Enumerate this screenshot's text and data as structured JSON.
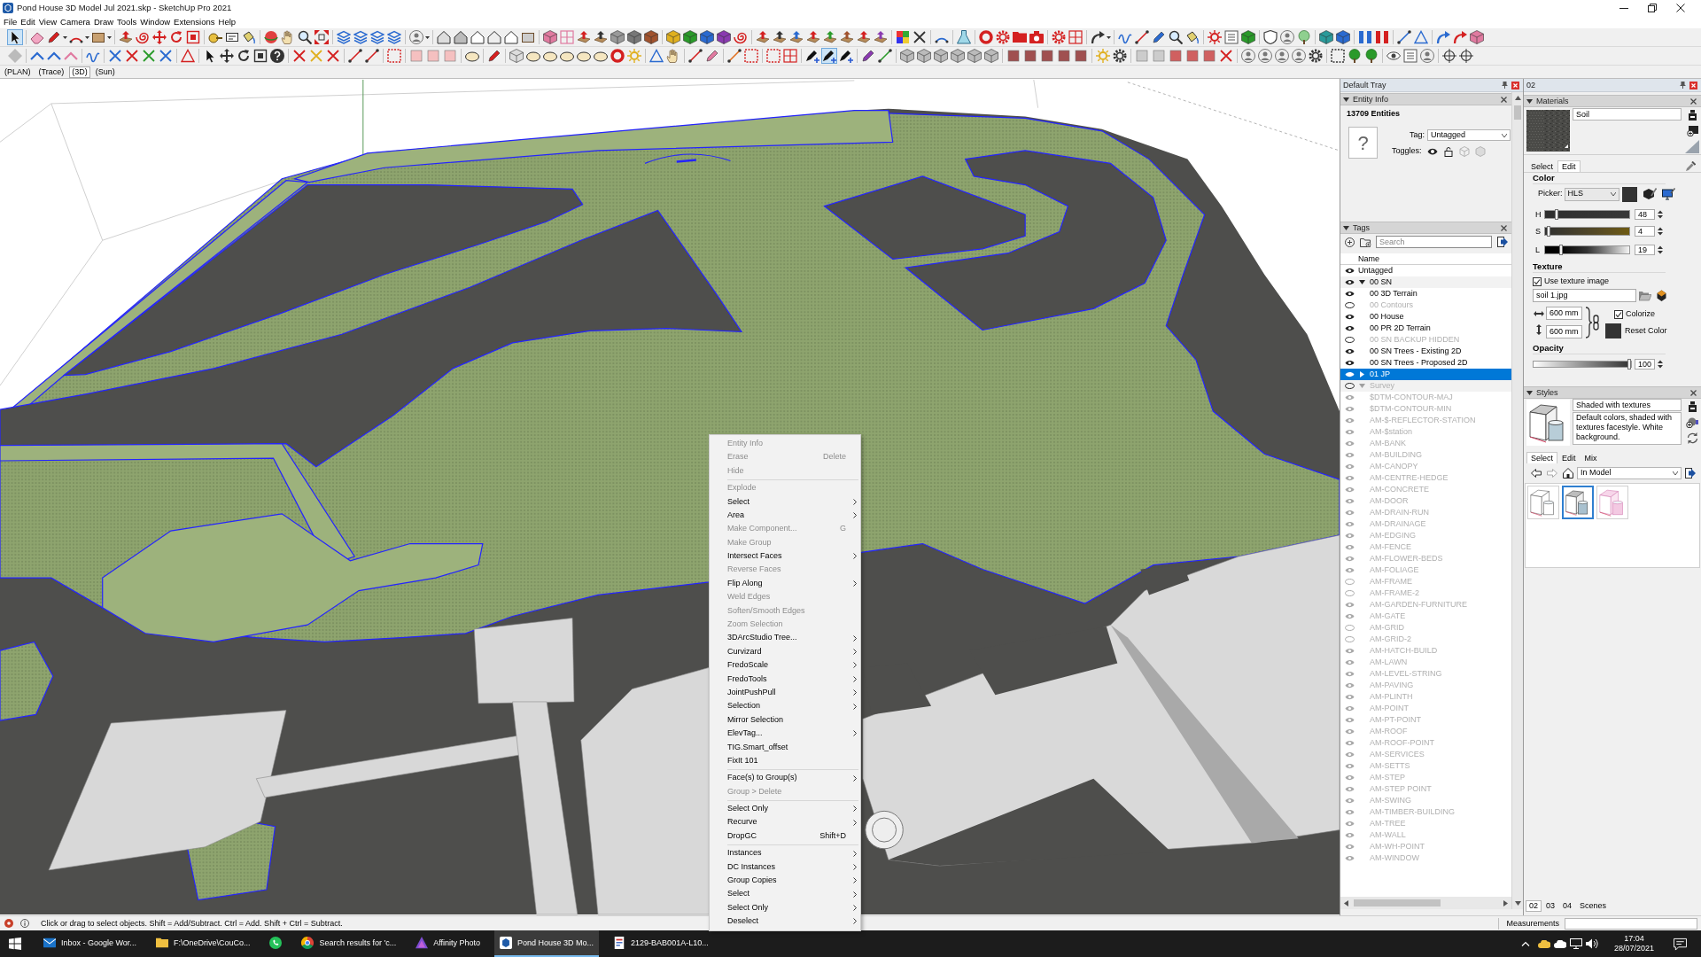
{
  "window": {
    "title": "Pond House 3D Model Jul 2021.skp - SketchUp Pro 2021"
  },
  "menu_bar": [
    "File",
    "Edit",
    "View",
    "Camera",
    "Draw",
    "Tools",
    "Window",
    "Extensions",
    "Help"
  ],
  "toolbars": [
    {
      "groups": [
        [
          {
            "selected": true
          }
        ],
        [
          {
            "selected": false
          },
          {
            "selected": false
          },
          {
            "selected": false
          },
          {
            "selected": false
          }
        ],
        [
          {
            "selected": false
          },
          {
            "selected": false
          },
          {
            "selected": false
          },
          {
            "selected": false
          },
          {
            "selected": false
          }
        ],
        [
          {
            "selected": false
          },
          {
            "selected": false
          },
          {
            "selected": false
          }
        ],
        [
          {
            "selected": false
          },
          {
            "selected": false
          },
          {
            "selected": false
          },
          {
            "selected": false
          }
        ],
        [
          {
            "selected": false
          },
          {
            "selected": false
          },
          {
            "selected": false
          },
          {
            "selected": false
          }
        ],
        [
          {
            "selected": false
          }
        ],
        [
          {
            "selected": false
          },
          {
            "selected": false
          },
          {
            "selected": false
          },
          {
            "selected": false
          },
          {
            "selected": false
          },
          {
            "selected": false
          }
        ],
        [
          {
            "selected": false
          },
          {
            "selected": false
          },
          {
            "selected": false
          },
          {
            "selected": false
          },
          {
            "selected": false
          },
          {
            "selected": false
          },
          {
            "selected": false
          }
        ],
        [
          {
            "selected": false
          },
          {
            "selected": false
          },
          {
            "selected": false
          },
          {
            "selected": false
          },
          {
            "selected": false
          }
        ],
        [
          {
            "selected": false
          },
          {
            "selected": false
          },
          {
            "selected": false
          },
          {
            "selected": false
          },
          {
            "selected": false
          },
          {
            "selected": false
          },
          {
            "selected": false
          },
          {
            "selected": false
          }
        ],
        [
          {
            "selected": false
          },
          {
            "selected": false
          }
        ],
        [
          {
            "selected": false
          }
        ],
        [
          {
            "selected": false
          }
        ],
        [
          {
            "selected": false
          },
          {
            "selected": false
          },
          {
            "selected": false
          },
          {
            "selected": false
          }
        ],
        [
          {
            "selected": false
          },
          {
            "selected": false
          }
        ],
        [
          {
            "selected": false
          }
        ],
        [
          {
            "selected": false
          },
          {
            "selected": false
          },
          {
            "selected": false
          },
          {
            "selected": false
          },
          {
            "selected": false
          }
        ],
        [
          {
            "selected": false
          },
          {
            "selected": false
          },
          {
            "selected": false
          }
        ],
        [
          {
            "selected": false
          },
          {
            "selected": false
          },
          {
            "selected": false
          }
        ],
        [
          {
            "selected": false
          },
          {
            "selected": false
          }
        ],
        [
          {
            "selected": false
          },
          {
            "selected": false
          }
        ],
        [
          {
            "selected": false
          },
          {
            "selected": false
          }
        ],
        [
          {
            "selected": false
          },
          {
            "selected": false
          },
          {
            "selected": false
          }
        ]
      ]
    },
    {
      "groups": [
        [
          {
            "selected": false
          }
        ],
        [
          {
            "selected": false
          },
          {
            "selected": false
          },
          {
            "selected": false
          }
        ],
        [
          {
            "selected": false
          }
        ],
        [
          {
            "selected": false
          },
          {
            "selected": false
          },
          {
            "selected": false
          },
          {
            "selected": false
          }
        ],
        [
          {
            "selected": false
          }
        ],
        [
          {
            "selected": false
          },
          {
            "selected": false
          },
          {
            "selected": false
          },
          {
            "selected": false
          },
          {
            "selected": false
          }
        ],
        [
          {
            "selected": false
          },
          {
            "selected": false
          },
          {
            "selected": false
          }
        ],
        [
          {
            "selected": false
          },
          {
            "selected": false
          }
        ],
        [
          {
            "selected": false
          }
        ],
        [
          {
            "selected": false
          },
          {
            "selected": false
          },
          {
            "selected": false
          }
        ],
        [
          {
            "selected": false
          }
        ],
        [
          {
            "selected": false
          }
        ],
        [
          {
            "selected": false
          },
          {
            "selected": false
          },
          {
            "selected": false
          },
          {
            "selected": false
          },
          {
            "selected": false
          },
          {
            "selected": false
          },
          {
            "selected": false
          },
          {
            "selected": false
          }
        ],
        [
          {
            "selected": false
          },
          {
            "selected": false
          }
        ],
        [
          {
            "selected": false
          },
          {
            "selected": false
          }
        ],
        [
          {
            "selected": false
          },
          {
            "selected": false
          }
        ],
        [
          {
            "selected": false
          },
          {
            "selected": false
          }
        ],
        [
          {
            "selected": false
          },
          {
            "selected": true
          },
          {
            "selected": false
          }
        ],
        [
          {
            "selected": false
          },
          {
            "selected": false
          }
        ],
        [
          {
            "selected": false
          },
          {
            "selected": false
          },
          {
            "selected": false
          },
          {
            "selected": false
          },
          {
            "selected": false
          },
          {
            "selected": false
          }
        ],
        [
          {
            "selected": false
          },
          {
            "selected": false
          },
          {
            "selected": false
          },
          {
            "selected": false
          },
          {
            "selected": false
          }
        ],
        [
          {
            "selected": false
          },
          {
            "selected": false
          }
        ],
        [
          {
            "selected": false
          },
          {
            "selected": false
          },
          {
            "selected": false
          },
          {
            "selected": false
          },
          {
            "selected": false
          },
          {
            "selected": false
          }
        ],
        [
          {
            "selected": false
          },
          {
            "selected": false
          },
          {
            "selected": false
          },
          {
            "selected": false
          },
          {
            "selected": false
          }
        ],
        [
          {
            "selected": false
          },
          {
            "selected": false
          },
          {
            "selected": false
          }
        ],
        [
          {
            "selected": false
          },
          {
            "selected": false
          },
          {
            "selected": false
          }
        ],
        [
          {
            "selected": false
          },
          {
            "selected": false
          }
        ]
      ]
    }
  ],
  "scene_tabs": [
    {
      "label": "(PLAN)",
      "selected": false
    },
    {
      "label": "(Trace)",
      "selected": false
    },
    {
      "label": "(3D)",
      "selected": true
    },
    {
      "label": "(Sun)",
      "selected": false
    }
  ],
  "context_menu": {
    "groups": [
      [
        {
          "label": "Entity Info",
          "disabled": true,
          "submenu": false
        },
        {
          "label": "Erase",
          "shortcut": "Delete",
          "disabled": true,
          "submenu": false
        },
        {
          "label": "Hide",
          "disabled": true,
          "submenu": false
        }
      ],
      [
        {
          "label": "Explode",
          "disabled": true,
          "submenu": false
        },
        {
          "label": "Select",
          "disabled": false,
          "submenu": true
        },
        {
          "label": "Area",
          "disabled": false,
          "submenu": true
        },
        {
          "label": "Make Component...",
          "shortcut": "G",
          "disabled": true,
          "submenu": false
        },
        {
          "label": "Make Group",
          "disabled": true,
          "submenu": false
        },
        {
          "label": "Intersect Faces",
          "disabled": false,
          "submenu": true
        },
        {
          "label": "Reverse Faces",
          "disabled": true,
          "submenu": false
        },
        {
          "label": "Flip Along",
          "disabled": false,
          "submenu": true
        },
        {
          "label": "Weld Edges",
          "disabled": true,
          "submenu": false
        },
        {
          "label": "Soften/Smooth Edges",
          "disabled": true,
          "submenu": false
        },
        {
          "label": "Zoom Selection",
          "disabled": true,
          "submenu": false
        },
        {
          "label": "3DArcStudio Tree...",
          "disabled": false,
          "submenu": true
        },
        {
          "label": "Curvizard",
          "disabled": false,
          "submenu": true
        },
        {
          "label": "FredoScale",
          "disabled": false,
          "submenu": true
        },
        {
          "label": "FredoTools",
          "disabled": false,
          "submenu": true
        },
        {
          "label": "JointPushPull",
          "disabled": false,
          "submenu": true
        },
        {
          "label": "Selection",
          "disabled": false,
          "submenu": true
        },
        {
          "label": "Mirror Selection",
          "disabled": false,
          "submenu": false
        },
        {
          "label": "ElevTag...",
          "disabled": false,
          "submenu": true
        },
        {
          "label": "TIG.Smart_offset",
          "disabled": false,
          "submenu": false
        },
        {
          "label": "FixIt 101",
          "disabled": false,
          "submenu": false
        }
      ],
      [
        {
          "label": "Face(s) to Group(s)",
          "disabled": false,
          "submenu": true
        },
        {
          "label": "Group > Delete",
          "disabled": true,
          "submenu": false
        }
      ],
      [
        {
          "label": "Select Only",
          "disabled": false,
          "submenu": true
        },
        {
          "label": "Recurve",
          "disabled": false,
          "submenu": true
        },
        {
          "label": "DropGC",
          "shortcut": "Shift+D",
          "disabled": false,
          "submenu": false
        }
      ],
      [
        {
          "label": "Instances",
          "disabled": false,
          "submenu": true
        },
        {
          "label": "DC Instances",
          "disabled": false,
          "submenu": true
        },
        {
          "label": "Group Copies",
          "disabled": false,
          "submenu": true
        },
        {
          "label": "Select",
          "disabled": false,
          "submenu": true
        },
        {
          "label": "Select Only",
          "disabled": false,
          "submenu": true
        },
        {
          "label": "Deselect",
          "disabled": false,
          "submenu": true
        }
      ]
    ]
  },
  "default_tray": {
    "title": "Default Tray",
    "entity_info": {
      "title": "Entity Info",
      "expanded": true,
      "count": "13709 Entities",
      "preview": "?",
      "tag_label": "Tag:",
      "tag_value": "Untagged",
      "toggles_label": "Toggles:",
      "toggles": [
        {
          "disabled": false
        },
        {
          "disabled": false
        },
        {
          "disabled": true
        },
        {
          "disabled": true
        }
      ]
    },
    "tags": {
      "title": "Tags",
      "expanded": true,
      "search": {
        "placeholder": "Search"
      },
      "column": "Name",
      "items": [
        {
          "name": "Untagged",
          "visible": true,
          "selected": false
        },
        {
          "name": "00 SN",
          "visible": true,
          "selected": false,
          "expanded": true,
          "children": [
            {
              "name": "00 3D Terrain",
              "visible": true,
              "selected": false
            },
            {
              "name": "00 Contours",
              "visible": false,
              "selected": false
            },
            {
              "name": "00 House",
              "visible": true,
              "selected": false
            },
            {
              "name": "00 PR 2D Terrain",
              "visible": true,
              "selected": false
            },
            {
              "name": "00 SN BACKUP HIDDEN",
              "visible": false,
              "selected": false
            },
            {
              "name": "00 SN Trees - Existing 2D",
              "visible": true,
              "selected": false
            },
            {
              "name": "00 SN Trees - Proposed 2D",
              "visible": true,
              "selected": false
            }
          ]
        },
        {
          "name": "01 JP",
          "visible": true,
          "selected": true,
          "expanded": false
        },
        {
          "name": "Survey",
          "visible": false,
          "selected": false,
          "expanded": true,
          "children": [
            {
              "name": "$DTM-CONTOUR-MAJ",
              "visible": true,
              "selected": false
            },
            {
              "name": "$DTM-CONTOUR-MIN",
              "visible": true,
              "selected": false
            },
            {
              "name": "AM-$-REFLECTOR-STATION",
              "visible": true,
              "selected": false
            },
            {
              "name": "AM-$station",
              "visible": true,
              "selected": false
            },
            {
              "name": "AM-BANK",
              "visible": true,
              "selected": false
            },
            {
              "name": "AM-BUILDING",
              "visible": true,
              "selected": false
            },
            {
              "name": "AM-CANOPY",
              "visible": true,
              "selected": false
            },
            {
              "name": "AM-CENTRE-HEDGE",
              "visible": true,
              "selected": false
            },
            {
              "name": "AM-CONCRETE",
              "visible": true,
              "selected": false
            },
            {
              "name": "AM-DOOR",
              "visible": true,
              "selected": false
            },
            {
              "name": "AM-DRAIN-RUN",
              "visible": true,
              "selected": false
            },
            {
              "name": "AM-DRAINAGE",
              "visible": true,
              "selected": false
            },
            {
              "name": "AM-EDGING",
              "visible": true,
              "selected": false
            },
            {
              "name": "AM-FENCE",
              "visible": true,
              "selected": false
            },
            {
              "name": "AM-FLOWER-BEDS",
              "visible": true,
              "selected": false
            },
            {
              "name": "AM-FOLIAGE",
              "visible": true,
              "selected": false
            },
            {
              "name": "AM-FRAME",
              "visible": false,
              "selected": false
            },
            {
              "name": "AM-FRAME-2",
              "visible": false,
              "selected": false
            },
            {
              "name": "AM-GARDEN-FURNITURE",
              "visible": true,
              "selected": false
            },
            {
              "name": "AM-GATE",
              "visible": true,
              "selected": false
            },
            {
              "name": "AM-GRID",
              "visible": false,
              "selected": false
            },
            {
              "name": "AM-GRID-2",
              "visible": false,
              "selected": false
            },
            {
              "name": "AM-HATCH-BUILD",
              "visible": true,
              "selected": false
            },
            {
              "name": "AM-LAWN",
              "visible": true,
              "selected": false
            },
            {
              "name": "AM-LEVEL-STRING",
              "visible": true,
              "selected": false
            },
            {
              "name": "AM-PAVING",
              "visible": true,
              "selected": false
            },
            {
              "name": "AM-PLINTH",
              "visible": true,
              "selected": false
            },
            {
              "name": "AM-POINT",
              "visible": true,
              "selected": false
            },
            {
              "name": "AM-PT-POINT",
              "visible": true,
              "selected": false
            },
            {
              "name": "AM-ROOF",
              "visible": true,
              "selected": false
            },
            {
              "name": "AM-ROOF-POINT",
              "visible": true,
              "selected": false
            },
            {
              "name": "AM-SERVICES",
              "visible": true,
              "selected": false
            },
            {
              "name": "AM-SETTS",
              "visible": true,
              "selected": false
            },
            {
              "name": "AM-STEP",
              "visible": true,
              "selected": false
            },
            {
              "name": "AM-STEP POINT",
              "visible": true,
              "selected": false
            },
            {
              "name": "AM-SWING",
              "visible": true,
              "selected": false
            },
            {
              "name": "AM-TIMBER-BUILDING",
              "visible": true,
              "selected": false
            },
            {
              "name": "AM-TREE",
              "visible": true,
              "selected": false
            },
            {
              "name": "AM-WALL",
              "visible": true,
              "selected": false
            },
            {
              "name": "AM-WH-POINT",
              "visible": true,
              "selected": false
            },
            {
              "name": "AM-WINDOW",
              "visible": true,
              "selected": false
            }
          ]
        }
      ]
    }
  },
  "tray_02": {
    "title": "02",
    "materials": {
      "title": "Materials",
      "expanded": true,
      "name": "Soil",
      "tabs": [
        {
          "label": "Select",
          "selected": false
        },
        {
          "label": "Edit",
          "selected": true
        }
      ],
      "color_heading": "Color",
      "picker_label": "Picker:",
      "picker_value": "HLS",
      "channels": [
        {
          "label": "H",
          "value": "48",
          "level": 0.133
        },
        {
          "label": "S",
          "value": "4",
          "level": 0.04
        },
        {
          "label": "L",
          "value": "19",
          "level": 0.19
        }
      ],
      "texture_heading": "Texture",
      "use_texture": {
        "label": "Use texture image",
        "checked": true
      },
      "texture_file": "soil 1.jpg",
      "texture_width": "600 mm",
      "texture_height": "600 mm",
      "colorize": {
        "label": "Colorize",
        "checked": true
      },
      "reset_color": "Reset Color",
      "opacity_heading": "Opacity",
      "opacity": {
        "value": "100",
        "level": 1
      }
    },
    "styles": {
      "title": "Styles",
      "expanded": true,
      "name": "Shaded with textures",
      "description": "Default colors, shaded with textures facestyle. White background.",
      "tabs": [
        {
          "label": "Select",
          "selected": true
        },
        {
          "label": "Edit",
          "selected": false
        },
        {
          "label": "Mix",
          "selected": false
        }
      ],
      "collection": "In Model",
      "thumbnails": [
        {
          "selected": false
        },
        {
          "selected": true
        },
        {
          "selected": false
        }
      ]
    },
    "tabs": [
      {
        "label": "02",
        "selected": true
      },
      {
        "label": "03",
        "selected": false
      },
      {
        "label": "04",
        "selected": false
      },
      {
        "label": "Scenes",
        "selected": false
      }
    ]
  },
  "status_bar": {
    "hint": "Click or drag to select objects. Shift = Add/Subtract. Ctrl = Add. Shift + Ctrl = Subtract.",
    "measurements_label": "Measurements"
  },
  "taskbar": {
    "items": [
      {
        "label": "Inbox - Google Wor...",
        "selected": false
      },
      {
        "label": "F:\\OneDrive\\CouCo...",
        "selected": false
      },
      {
        "selected": false
      },
      {
        "label": "Search results for 'c...",
        "selected": false
      },
      {
        "label": "Affinity Photo",
        "selected": false
      },
      {
        "label": "Pond House 3D Mo...",
        "selected": true
      },
      {
        "label": "2129-BAB001A-L10...",
        "selected": false
      }
    ],
    "time": "17:04",
    "date": "28/07/2021"
  }
}
